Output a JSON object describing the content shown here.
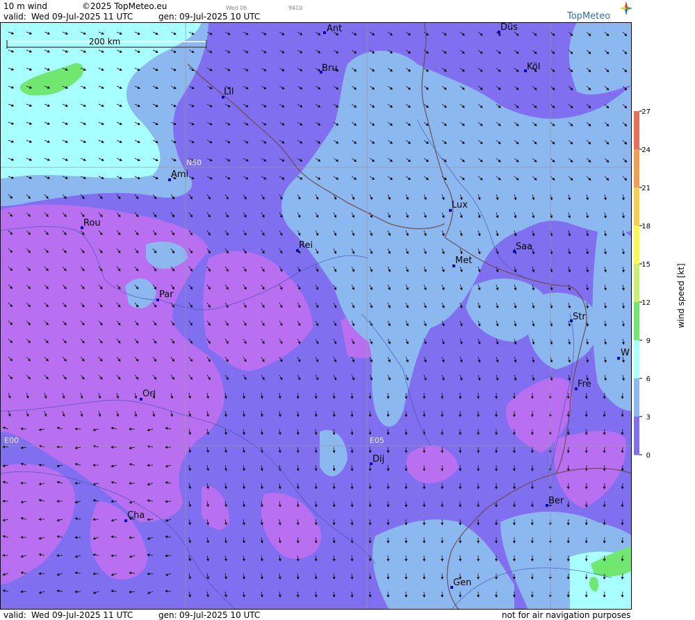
{
  "header": {
    "title": "10 m wind",
    "copyright": "©2025 TopMeteo.eu",
    "valid_label": "valid:",
    "valid_value": "Wed  09-Jul-2025  11 UTC",
    "gen_label": "gen:",
    "gen_value": "09-Jul-2025 10 UTC",
    "faint_1": "Wed 06",
    "faint_2": "9410"
  },
  "logo": {
    "text": "TopMeteo"
  },
  "scale_bar": {
    "label": "200 km"
  },
  "grid_labels": [
    "N50",
    "E00",
    "E05"
  ],
  "cities": [
    "Ant",
    "Düs",
    "Bru",
    "Köl",
    "Lil",
    "Ami",
    "Rou",
    "Lux",
    "Rei",
    "Saa",
    "Met",
    "Par",
    "Str",
    "W",
    "Fre",
    "Orl",
    "Dij",
    "Ber",
    "Cha",
    "Gen"
  ],
  "legend": {
    "title": "wind  speed  [kt]",
    "ticks": [
      "27",
      "24",
      "21",
      "18",
      "15",
      "12",
      "9",
      "6",
      "3",
      "0"
    ],
    "colors": [
      "#e8705a",
      "#f0a050",
      "#f5d050",
      "#f8f850",
      "#c8f070",
      "#70e870",
      "#a8ffff",
      "#8cb8f0",
      "#8070f0",
      "#b870f0"
    ]
  },
  "footer": {
    "valid_label": "valid:",
    "valid_value": "Wed  09-Jul-2025  11 UTC",
    "gen_label": "gen:",
    "gen_value": "09-Jul-2025 10 UTC",
    "disclaimer": "not for air navigation purposes"
  }
}
